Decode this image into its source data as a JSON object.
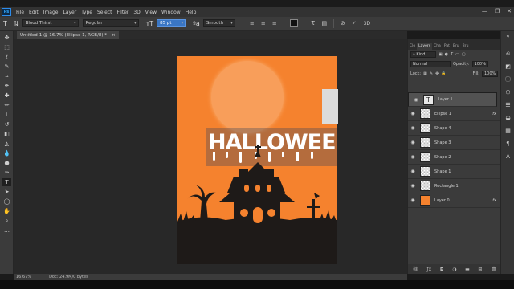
{
  "menu": [
    "File",
    "Edit",
    "Image",
    "Layer",
    "Type",
    "Select",
    "Filter",
    "3D",
    "View",
    "Window",
    "Help"
  ],
  "window_controls": [
    "—",
    "❐",
    "✕"
  ],
  "options": {
    "font_family": "Blood Thirst",
    "font_style": "Regular",
    "font_size": "85 pt",
    "antialias": "Smooth",
    "text_color": "#111111",
    "cancel_label": "⊘",
    "commit_label": "✓",
    "mode_3d": "3D"
  },
  "document_tab": {
    "title": "Untitled-1 @ 16.7% (Ellipse 1, RGB/8) *",
    "close": "×"
  },
  "canvas": {
    "text": "HALLOWEE",
    "background_color": "#f5822e",
    "ground_color": "#1e1a18"
  },
  "status": {
    "zoom": "16.67%",
    "doc_info": "Doc: 24.9M/0 bytes"
  },
  "panel_tabs": [
    "Clo",
    "Layers",
    "Cha",
    "Pat",
    "Bru",
    "Bru"
  ],
  "layers_panel": {
    "filter_label": "Kind",
    "blend_mode": "Normal",
    "opacity_label": "Opacity:",
    "opacity_value": "100%",
    "lock_label": "Lock:",
    "fill_label": "Fill:",
    "fill_value": "100%",
    "layers": [
      {
        "name": "Layer 1",
        "thumb": "text",
        "fx": "",
        "selected": true
      },
      {
        "name": "Ellipse 1",
        "thumb": "checker",
        "fx": "fx",
        "selected": false
      },
      {
        "name": "Shape 4",
        "thumb": "checker",
        "fx": "",
        "selected": false
      },
      {
        "name": "Shape 3",
        "thumb": "checker",
        "fx": "",
        "selected": false
      },
      {
        "name": "Shape 2",
        "thumb": "checker",
        "fx": "",
        "selected": false
      },
      {
        "name": "Shape 1",
        "thumb": "checker",
        "fx": "",
        "selected": false
      },
      {
        "name": "Rectangle 1",
        "thumb": "checker",
        "fx": "",
        "selected": false
      },
      {
        "name": "Layer 0",
        "thumb": "orange",
        "fx": "fx",
        "selected": false
      }
    ]
  },
  "colors": {
    "foreground": "#111111",
    "background": "#f5822e"
  }
}
